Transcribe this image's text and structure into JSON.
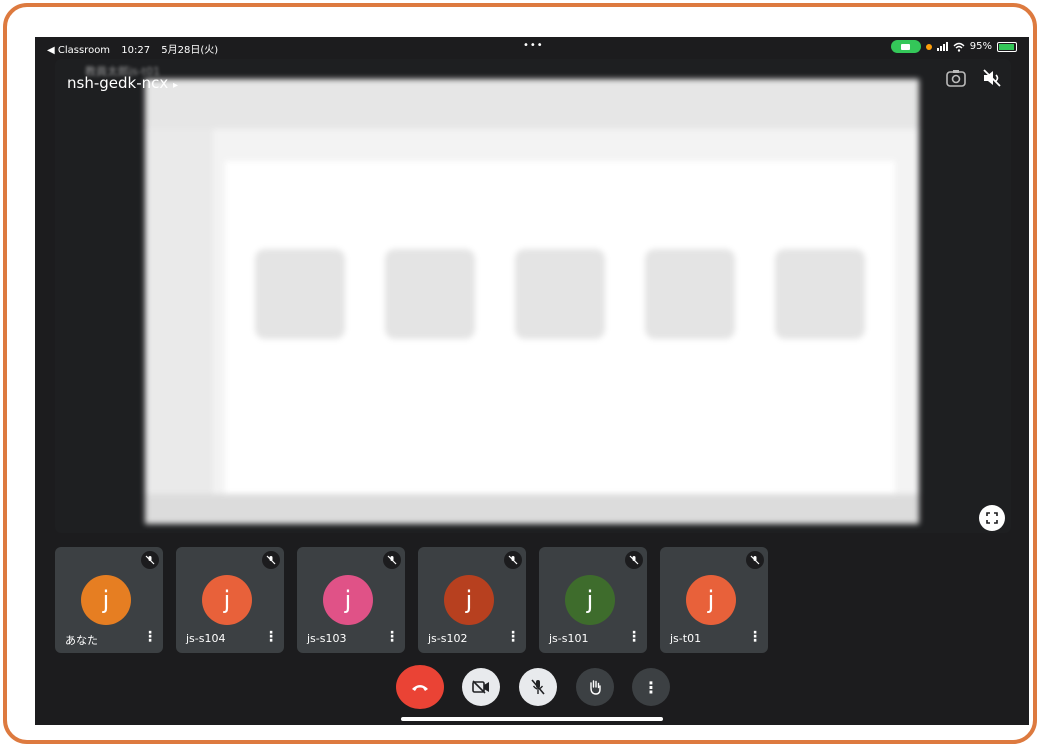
{
  "status_bar": {
    "back_app": "◀ Classroom",
    "time": "10:27",
    "date": "5月28日(火)",
    "dots": "•••",
    "battery": "95%"
  },
  "meeting": {
    "code": "nsh-gedk-ncx",
    "blurred_title": "教員太郎js-t01"
  },
  "participants": [
    {
      "name": "あなた",
      "initial": "j",
      "color": "#e67e22"
    },
    {
      "name": "js-s104",
      "initial": "j",
      "color": "#e8613a"
    },
    {
      "name": "js-s103",
      "initial": "j",
      "color": "#e05287"
    },
    {
      "name": "js-s102",
      "initial": "j",
      "color": "#b7401f"
    },
    {
      "name": "js-s101",
      "initial": "j",
      "color": "#3e6c2c"
    },
    {
      "name": "js-t01",
      "initial": "j",
      "color": "#e8613a"
    }
  ],
  "colors": {
    "frame": "#dd7a3f",
    "end_call": "#ea4335",
    "control_light": "#e8eaed",
    "control_dark": "#3c4043"
  }
}
